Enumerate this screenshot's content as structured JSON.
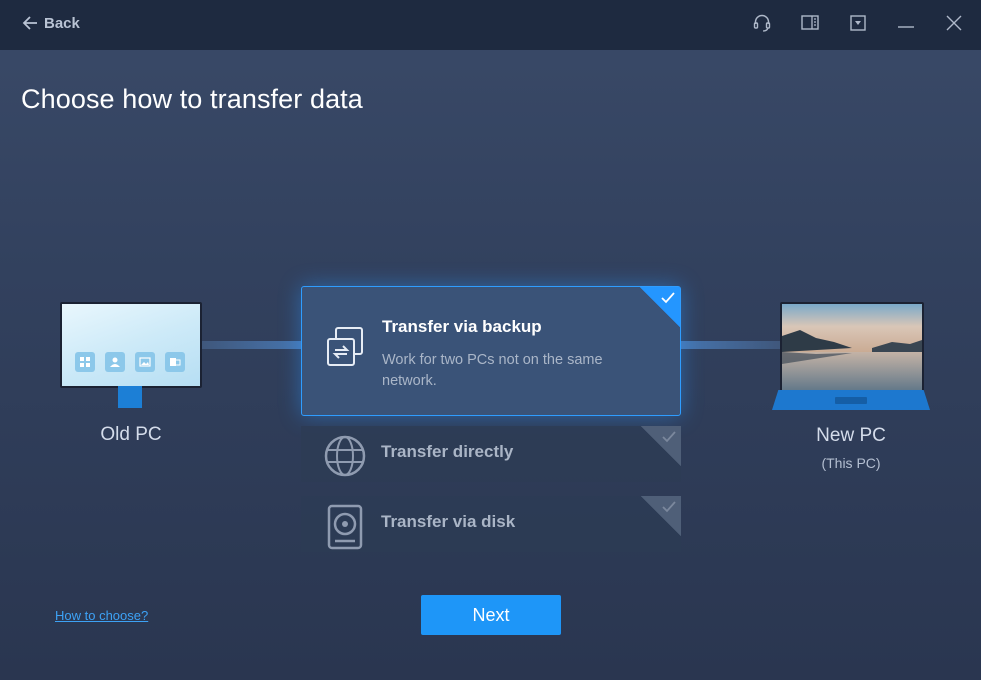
{
  "header": {
    "back_label": "Back",
    "icons": [
      "headset-icon",
      "book-icon",
      "dropdown-icon",
      "minimize-icon",
      "close-icon"
    ]
  },
  "page": {
    "title": "Choose how to transfer data"
  },
  "old_pc": {
    "label": "Old PC"
  },
  "new_pc": {
    "label": "New PC",
    "sublabel": "(This PC)"
  },
  "options": [
    {
      "title": "Transfer via backup",
      "description": "Work for two PCs not on the same network.",
      "selected": true,
      "icon": "backup-transfer-icon"
    },
    {
      "title": "Transfer directly",
      "description": "",
      "selected": false,
      "icon": "globe-icon"
    },
    {
      "title": "Transfer via disk",
      "description": "",
      "selected": false,
      "icon": "disk-icon"
    }
  ],
  "footer": {
    "help_link": "How to choose?",
    "next_label": "Next"
  },
  "colors": {
    "accent": "#1e96f8",
    "titlebar": "#1e2a40",
    "background": "#3a4a68"
  }
}
